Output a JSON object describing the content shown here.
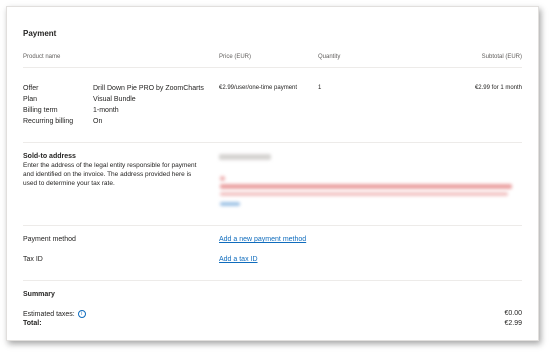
{
  "payment": {
    "title": "Payment",
    "headers": {
      "product_name": "Product name",
      "price": "Price (EUR)",
      "quantity": "Quantity",
      "subtotal": "Subtotal (EUR)"
    },
    "details": [
      {
        "label": "Offer",
        "value": "Drill Down Pie PRO by ZoomCharts"
      },
      {
        "label": "Plan",
        "value": "Visual Bundle"
      },
      {
        "label": "Billing term",
        "value": "1-month"
      },
      {
        "label": "Recurring billing",
        "value": "On"
      }
    ],
    "price_value": "€2.99/user/one-time payment",
    "quantity_value": "1",
    "subtotal_value": "€2.99 for 1 month"
  },
  "sold_to": {
    "title": "Sold-to address",
    "description": "Enter the address of the legal entity responsible for payment and identified on the invoice. The address provided here is used to determine your tax rate."
  },
  "payment_method": {
    "label": "Payment method",
    "link": "Add a new payment method"
  },
  "tax_id": {
    "label": "Tax ID",
    "link": "Add a tax ID"
  },
  "summary": {
    "title": "Summary",
    "estimated_taxes_label": "Estimated taxes:",
    "estimated_taxes_value": "€0.00",
    "total_label": "Total:",
    "total_value": "€2.99",
    "info_icon": "info-icon"
  },
  "colors": {
    "link": "#0f6cbd",
    "redacted_text": "#e8a6a6"
  }
}
